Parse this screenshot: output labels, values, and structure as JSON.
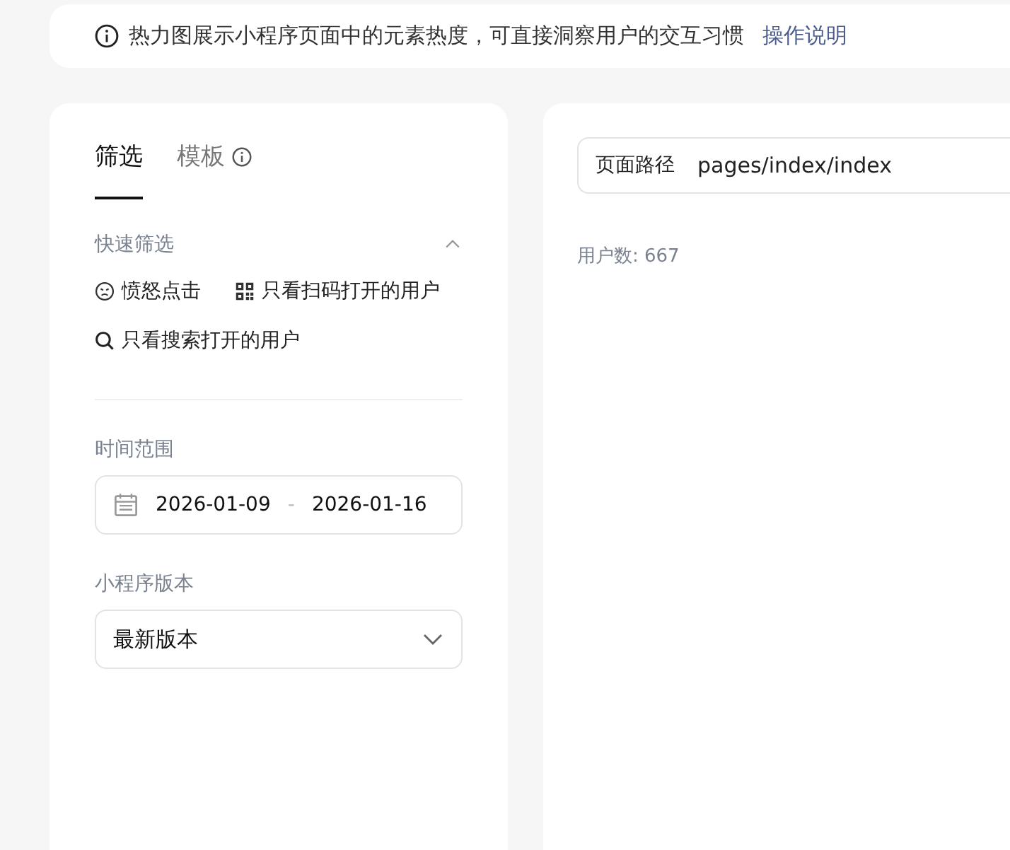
{
  "notice": {
    "text": "热力图展示小程序页面中的元素热度，可直接洞察用户的交互习惯",
    "link": "操作说明"
  },
  "filter_panel": {
    "tabs": [
      {
        "label": "筛选",
        "selected": true,
        "info": false
      },
      {
        "label": "模板",
        "selected": false,
        "info": true
      }
    ],
    "quick_filter": {
      "label": "快速筛选",
      "expanded": true,
      "options": [
        {
          "label": "愤怒点击",
          "kind": "angry"
        },
        {
          "label": "只看扫码打开的用户",
          "kind": "qrcode"
        },
        {
          "label": "只看搜索打开的用户",
          "kind": "search"
        }
      ]
    },
    "time_range": {
      "label": "时间范围",
      "start": "2026-01-09",
      "separator": "-",
      "end": "2026-01-16"
    },
    "version": {
      "label": "小程序版本",
      "value": "最新版本"
    }
  },
  "heatmap_panel": {
    "page_path": {
      "label": "页面路径",
      "value": "pages/index/index"
    },
    "user_count": "用户数: 667"
  }
}
